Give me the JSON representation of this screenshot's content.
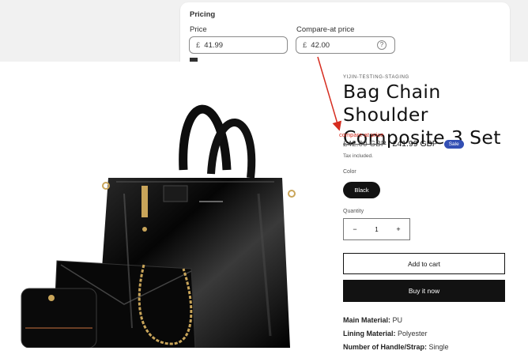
{
  "pricing": {
    "title": "Pricing",
    "price_label": "Price",
    "price_currency": "£",
    "price_value": "41.99",
    "compare_label": "Compare-at price",
    "compare_currency": "£",
    "compare_value": "42.00",
    "help_icon": "question-circle-icon"
  },
  "product": {
    "vendor": "YIJIN-TESTING-STAGING",
    "title": "Bag Chain Shoulder Composite 3 Set",
    "compare_price": "£42.00 GBP",
    "sale_price": "£41.99 GBP",
    "sale_badge": "Sale",
    "tax_note": "Tax included.",
    "color_label": "Color",
    "color_value": "Black",
    "quantity_label": "Quantity",
    "quantity_minus": "−",
    "quantity_value": "1",
    "quantity_plus": "+",
    "add_to_cart": "Add to cart",
    "buy_now": "Buy it now",
    "specs": [
      {
        "label": "Main Material:",
        "value": " PU"
      },
      {
        "label": "Lining Material:",
        "value": " Polyester"
      },
      {
        "label": "Number of Handle/Strap:",
        "value": " Single"
      }
    ]
  },
  "annotation": {
    "label": "compare-at price",
    "color": "#d62d20"
  },
  "colors": {
    "sale_badge": "#334fb4",
    "button_dark": "#121212"
  }
}
